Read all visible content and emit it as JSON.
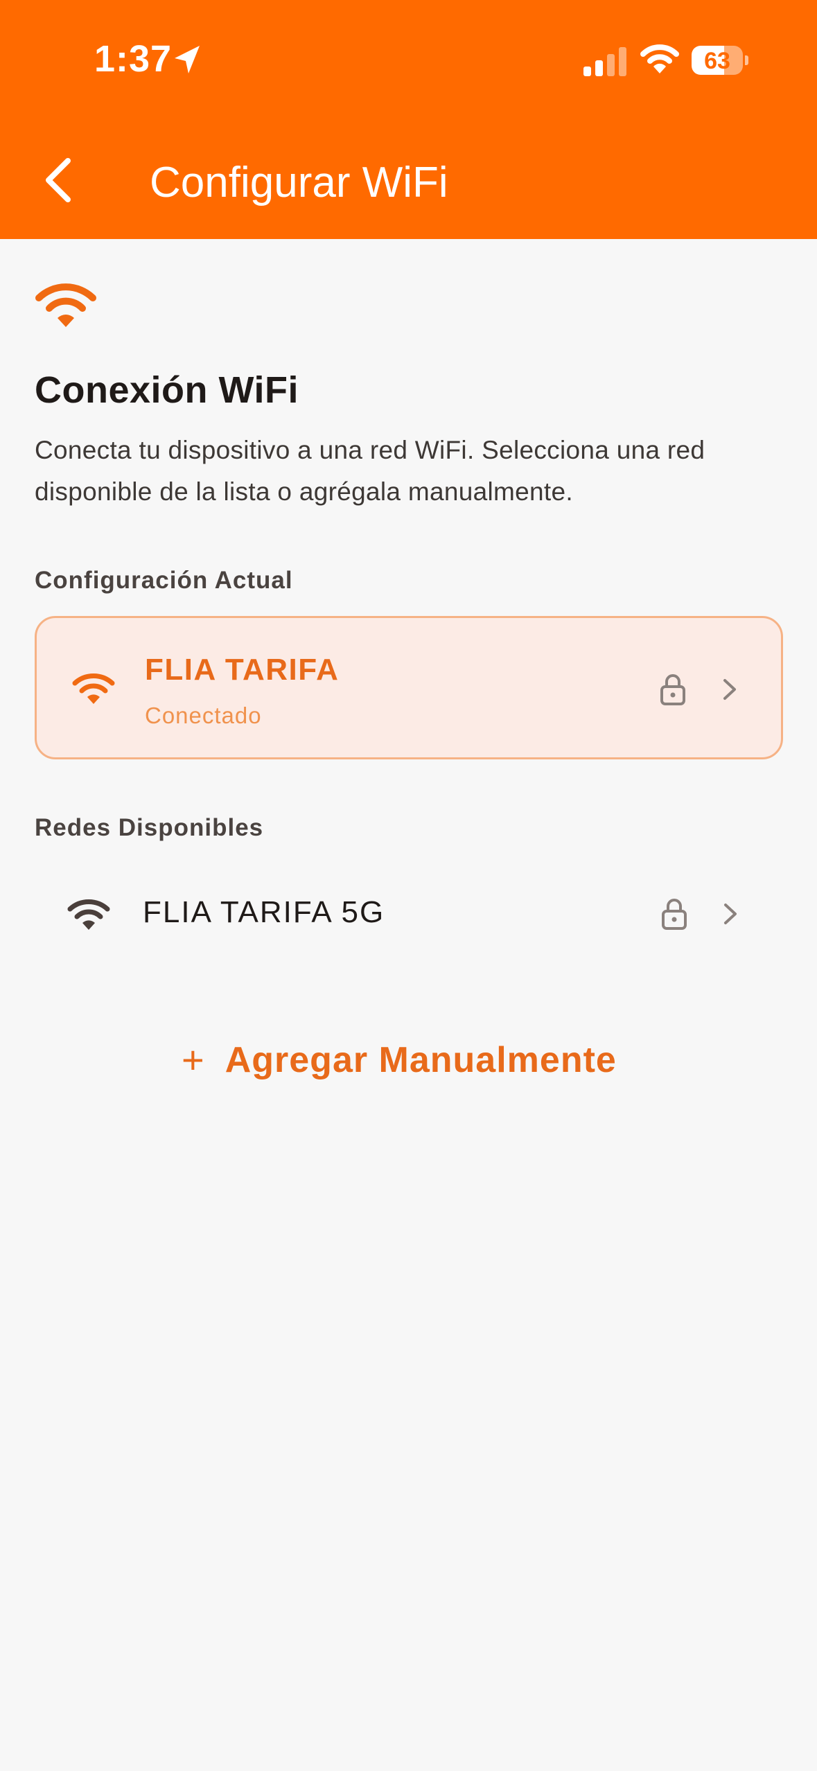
{
  "status_bar": {
    "time": "1:37",
    "battery": "63",
    "battery_level": 0.63,
    "icons": [
      "location-arrow-icon",
      "signal-icon",
      "wifi-icon",
      "battery-icon"
    ]
  },
  "header": {
    "title": "Configurar WiFi",
    "back_icon": "chevron-left-icon",
    "background_color": "#ff6a00"
  },
  "intro": {
    "icon": "wifi-icon",
    "title": "Conexión WiFi",
    "description": "Conecta tu dispositivo a una red WiFi. Selecciona una red disponible de la lista o agrégala manualmente."
  },
  "current": {
    "section_label": "Configuración Actual",
    "network_name": "FLIA TARIFA",
    "status": "Conectado",
    "secured": true
  },
  "available": {
    "section_label": "Redes Disponibles",
    "networks": [
      {
        "name": "FLIA TARIFA 5G",
        "secured": true
      }
    ]
  },
  "add_manual": {
    "icon": "plus-icon",
    "label": "Agregar Manualmente"
  },
  "colors": {
    "accent": "#ff6a00",
    "accent_text": "#e86a1a",
    "card_background": "#fcebe5",
    "card_border": "#f6b285",
    "page_background": "#f7f7f7"
  }
}
